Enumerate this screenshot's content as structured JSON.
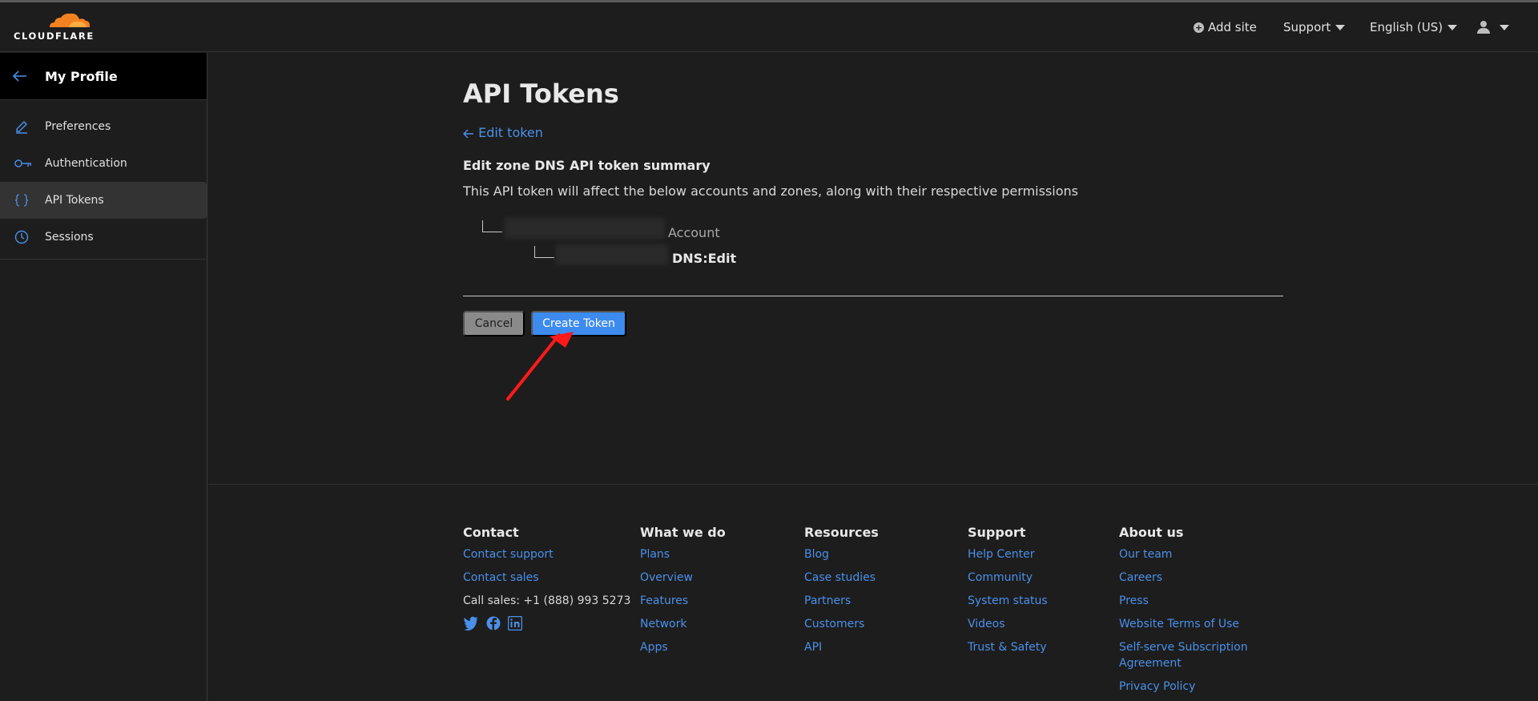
{
  "brand": {
    "logo_text": "CLOUDFLARE",
    "accent": "#f48120"
  },
  "topnav": {
    "add_site": "Add site",
    "support": "Support",
    "language": "English (US)"
  },
  "sidebar": {
    "header": "My Profile",
    "items": [
      {
        "label": "Preferences",
        "icon": "pencil-icon"
      },
      {
        "label": "Authentication",
        "icon": "key-icon"
      },
      {
        "label": "API Tokens",
        "icon": "braces-icon",
        "active": true
      },
      {
        "label": "Sessions",
        "icon": "clock-icon"
      }
    ]
  },
  "main": {
    "title": "API Tokens",
    "back_link": "Edit token",
    "summary_title": "Edit zone DNS API token summary",
    "summary_desc": "This API token will affect the below accounts and zones, along with their respective permissions",
    "account_label": "Account",
    "permission_label": "DNS:Edit",
    "cancel_label": "Cancel",
    "create_label": "Create Token"
  },
  "footer": {
    "contact": {
      "heading": "Contact",
      "links": [
        "Contact support",
        "Contact sales"
      ],
      "call": "Call sales: +1 (888) 993 5273"
    },
    "what_we_do": {
      "heading": "What we do",
      "links": [
        "Plans",
        "Overview",
        "Features",
        "Network",
        "Apps"
      ]
    },
    "resources": {
      "heading": "Resources",
      "links": [
        "Blog",
        "Case studies",
        "Partners",
        "Customers",
        "API"
      ]
    },
    "support": {
      "heading": "Support",
      "links": [
        "Help Center",
        "Community",
        "System status",
        "Videos",
        "Trust & Safety"
      ]
    },
    "about": {
      "heading": "About us",
      "links": [
        "Our team",
        "Careers",
        "Press",
        "Website Terms of Use",
        "Self-serve Subscription",
        "Agreement",
        "Privacy Policy"
      ]
    }
  },
  "colors": {
    "link": "#4a90ea",
    "primary_button": "#3d8bef",
    "annotation_arrow": "#ff1a1a"
  }
}
